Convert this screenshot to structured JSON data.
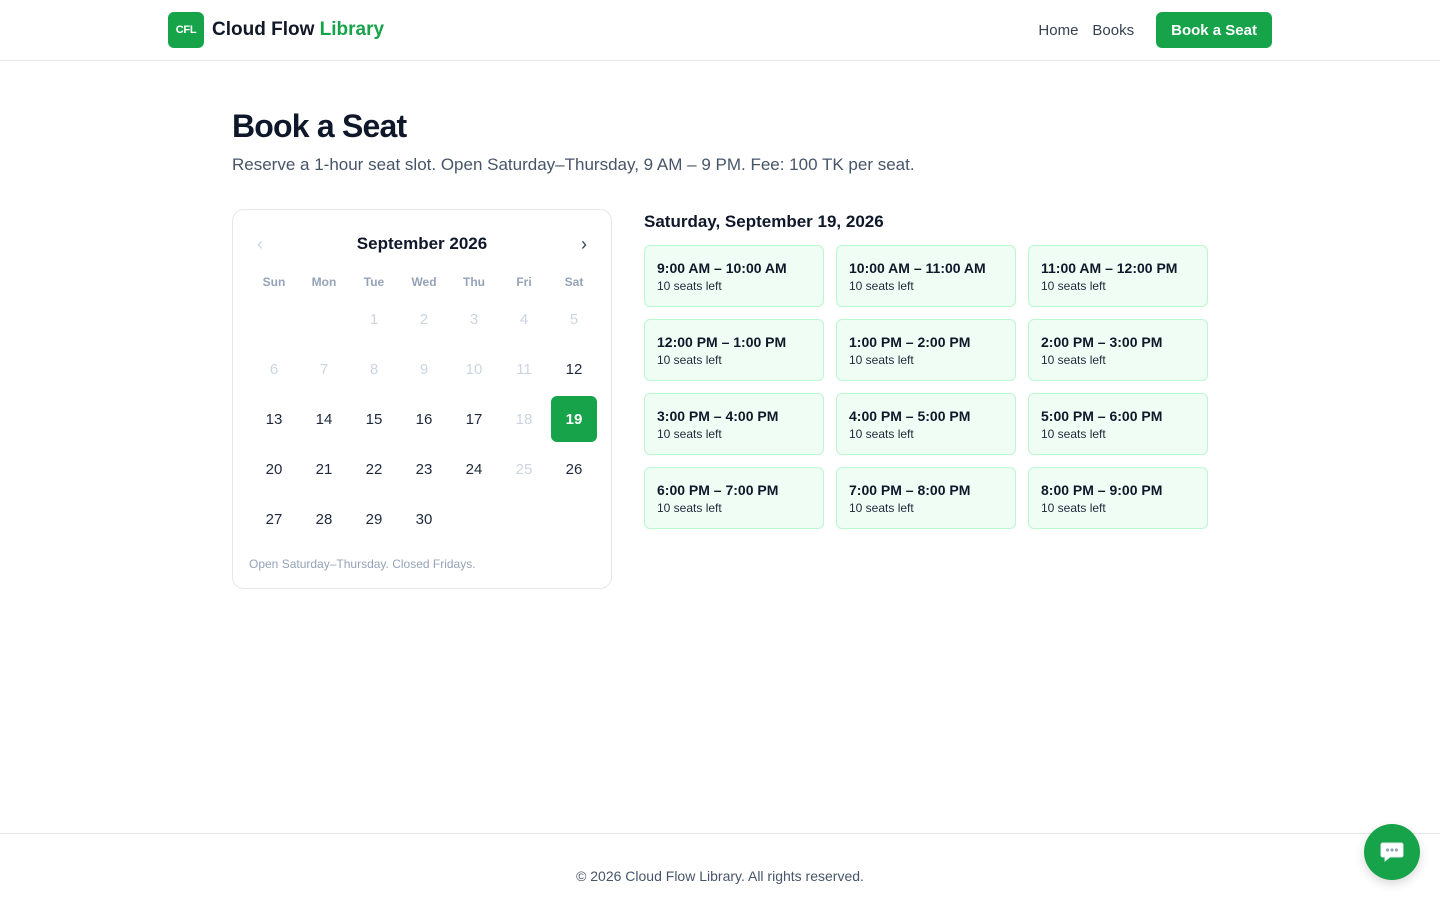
{
  "brand": {
    "logo_text": "CFL",
    "name_main": "Cloud Flow",
    "name_accent": "Library",
    "accent_color": "#16a34a"
  },
  "nav": {
    "home": "Home",
    "books": "Books",
    "cta": "Book a Seat"
  },
  "page": {
    "title": "Book a Seat",
    "subtitle": "Reserve a 1-hour seat slot. Open Saturday–Thursday, 9 AM – 9 PM. Fee: 100 TK per seat."
  },
  "calendar": {
    "month_label": "September 2026",
    "prev_icon": "chevron-left-icon",
    "next_icon": "chevron-right-icon",
    "weekdays": [
      "Sun",
      "Mon",
      "Tue",
      "Wed",
      "Thu",
      "Fri",
      "Sat"
    ],
    "leading_blanks": 2,
    "days": [
      {
        "n": "1",
        "state": "disabled"
      },
      {
        "n": "2",
        "state": "disabled"
      },
      {
        "n": "3",
        "state": "disabled"
      },
      {
        "n": "4",
        "state": "disabled"
      },
      {
        "n": "5",
        "state": "disabled"
      },
      {
        "n": "6",
        "state": "disabled"
      },
      {
        "n": "7",
        "state": "disabled"
      },
      {
        "n": "8",
        "state": "disabled"
      },
      {
        "n": "9",
        "state": "disabled"
      },
      {
        "n": "10",
        "state": "disabled"
      },
      {
        "n": "11",
        "state": "disabled"
      },
      {
        "n": "12",
        "state": "available"
      },
      {
        "n": "13",
        "state": "available"
      },
      {
        "n": "14",
        "state": "available"
      },
      {
        "n": "15",
        "state": "available"
      },
      {
        "n": "16",
        "state": "available"
      },
      {
        "n": "17",
        "state": "available"
      },
      {
        "n": "18",
        "state": "disabled"
      },
      {
        "n": "19",
        "state": "selected"
      },
      {
        "n": "20",
        "state": "available"
      },
      {
        "n": "21",
        "state": "available"
      },
      {
        "n": "22",
        "state": "available"
      },
      {
        "n": "23",
        "state": "available"
      },
      {
        "n": "24",
        "state": "available"
      },
      {
        "n": "25",
        "state": "disabled"
      },
      {
        "n": "26",
        "state": "available"
      },
      {
        "n": "27",
        "state": "available"
      },
      {
        "n": "28",
        "state": "available"
      },
      {
        "n": "29",
        "state": "available"
      },
      {
        "n": "30",
        "state": "available"
      }
    ],
    "note": "Open Saturday–Thursday. Closed Fridays."
  },
  "slots": {
    "date_label": "Saturday, September 19, 2026",
    "items": [
      {
        "time": "9:00 AM – 10:00 AM",
        "seats": "10 seats left"
      },
      {
        "time": "10:00 AM – 11:00 AM",
        "seats": "10 seats left"
      },
      {
        "time": "11:00 AM – 12:00 PM",
        "seats": "10 seats left"
      },
      {
        "time": "12:00 PM – 1:00 PM",
        "seats": "10 seats left"
      },
      {
        "time": "1:00 PM – 2:00 PM",
        "seats": "10 seats left"
      },
      {
        "time": "2:00 PM – 3:00 PM",
        "seats": "10 seats left"
      },
      {
        "time": "3:00 PM – 4:00 PM",
        "seats": "10 seats left"
      },
      {
        "time": "4:00 PM – 5:00 PM",
        "seats": "10 seats left"
      },
      {
        "time": "5:00 PM – 6:00 PM",
        "seats": "10 seats left"
      },
      {
        "time": "6:00 PM – 7:00 PM",
        "seats": "10 seats left"
      },
      {
        "time": "7:00 PM – 8:00 PM",
        "seats": "10 seats left"
      },
      {
        "time": "8:00 PM – 9:00 PM",
        "seats": "10 seats left"
      }
    ]
  },
  "footer": {
    "text": "© 2026 Cloud Flow Library. All rights reserved."
  },
  "chat": {
    "icon": "chat-bubble-icon"
  }
}
